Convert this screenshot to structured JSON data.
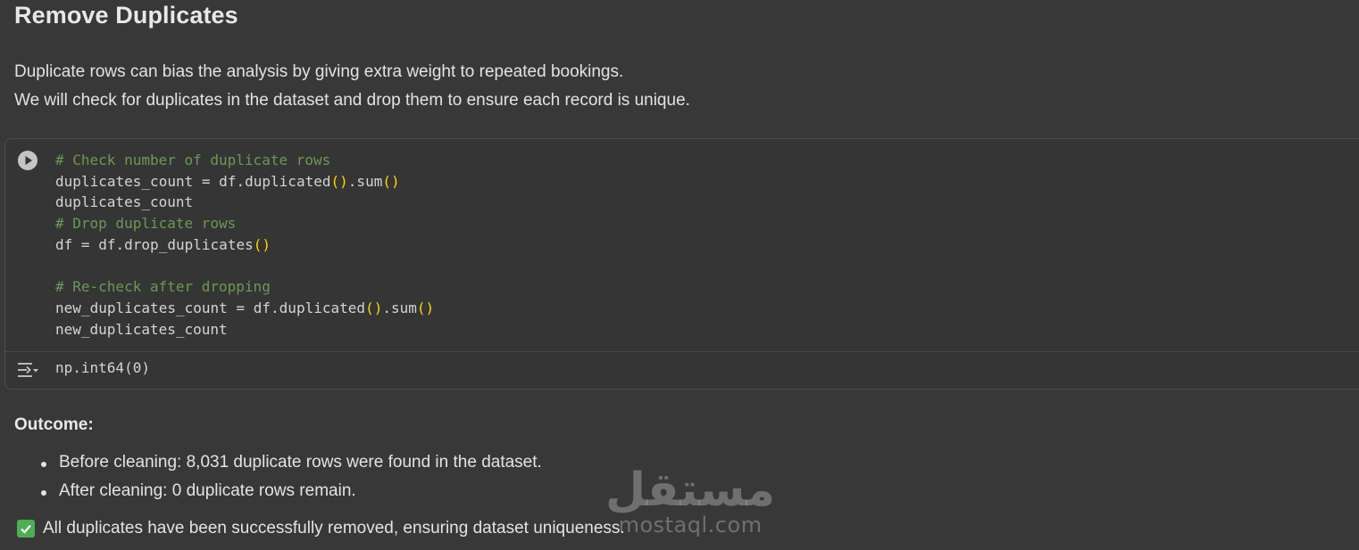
{
  "heading": "Remove Duplicates",
  "intro": [
    "Duplicate rows can bias the analysis by giving extra weight to repeated bookings.",
    "We will check for duplicates in the dataset and drop them to ensure each record is unique."
  ],
  "code_cell": {
    "run_icon": "play-circle-icon",
    "lines": [
      "# Check number of duplicate rows",
      "duplicates_count = df.duplicated().sum()",
      "duplicates_count",
      "# Drop duplicate rows",
      "df = df.drop_duplicates()",
      "",
      "# Re-check after dropping",
      "new_duplicates_count = df.duplicated().sum()",
      "new_duplicates_count"
    ],
    "output_icon": "output-toggle-icon",
    "output": "np.int64(0)"
  },
  "outcome": {
    "label": "Outcome:",
    "bullets": [
      "Before cleaning: 8,031 duplicate rows were found in the dataset.",
      "After cleaning: 0 duplicate rows remain."
    ],
    "check_icon": "check-box-icon",
    "conclusion": "All duplicates have been successfully removed, ensuring dataset uniqueness."
  },
  "watermark": {
    "arabic": "مستقل",
    "latin": "mostaql.com"
  },
  "colors": {
    "background": "#383838",
    "comment": "#6a9955",
    "bracket": "#ffd700",
    "check": "#4caf50"
  }
}
